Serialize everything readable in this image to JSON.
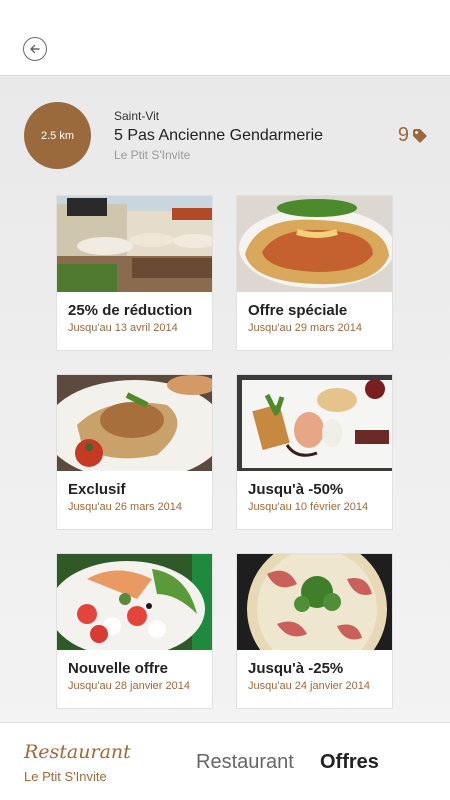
{
  "colors": {
    "accent": "#9b6a3c",
    "background": "#efefef"
  },
  "header": {
    "distance": "2.5 km",
    "city": "Saint-Vit",
    "address": "5 Pas Ancienne Gendarmerie",
    "restaurant_name": "Le Ptit S'Invite",
    "offer_count": "9",
    "tag_icon": "tag-icon"
  },
  "offers": [
    {
      "title": "25% de réduction",
      "date": "Jusqu'au 13 avril 2014",
      "photo": "restaurant-terrace-photo"
    },
    {
      "title": "Offre spéciale",
      "date": "Jusqu'au 29 mars 2014",
      "photo": "calzone-photo"
    },
    {
      "title": "Exclusif",
      "date": "Jusqu'au 26 mars 2014",
      "photo": "chicken-dish-photo"
    },
    {
      "title": "Jusqu'à -50%",
      "date": "Jusqu'au 10 février 2014",
      "photo": "plated-dish-photo"
    },
    {
      "title": "Nouvelle offre",
      "date": "Jusqu'au 28 janvier 2014",
      "photo": "salad-photo"
    },
    {
      "title": "Jusqu'à -25%",
      "date": "Jusqu'au 24 janvier 2014",
      "photo": "pizza-photo"
    }
  ],
  "footer": {
    "logo_script": "Restaurant",
    "logo_sub": "Le Ptit S'Invite",
    "tabs": [
      "Restaurant",
      "Offres"
    ]
  }
}
